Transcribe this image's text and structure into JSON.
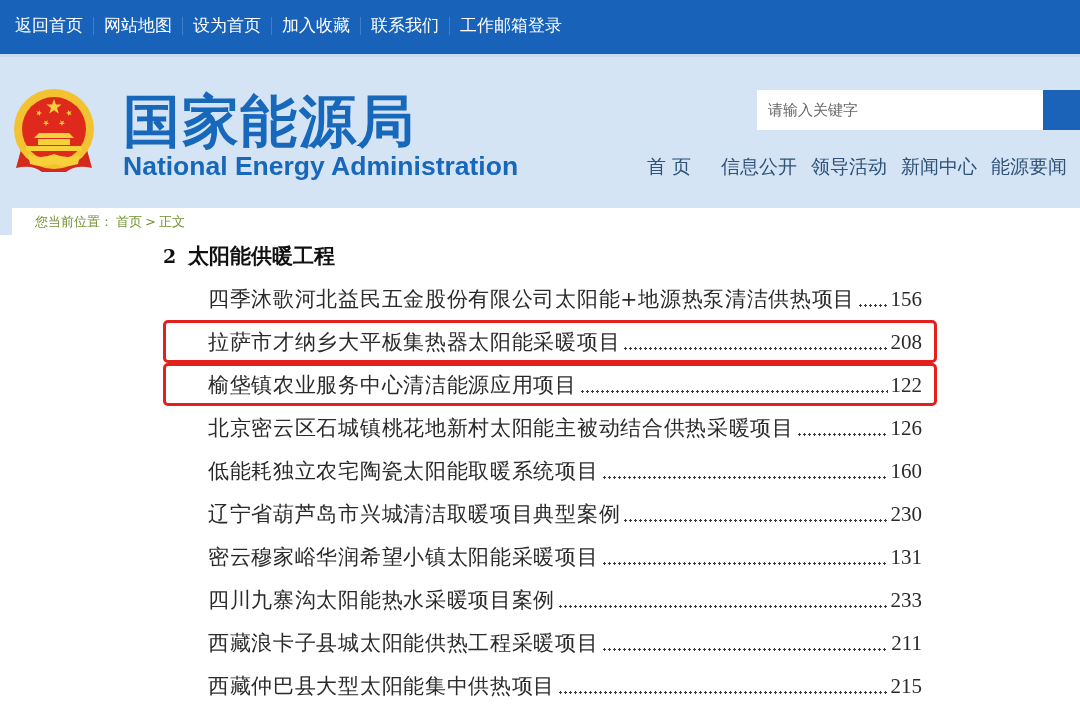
{
  "top_links": [
    "返回首页",
    "网站地图",
    "设为首页",
    "加入收藏",
    "联系我们",
    "工作邮箱登录"
  ],
  "header": {
    "title": "国家能源局",
    "subtitle": "National Energy Administration",
    "search": {
      "placeholder": "请输入关键字"
    },
    "nav": [
      "首 页",
      "信息公开",
      "领导活动",
      "新闻中心",
      "能源要闻"
    ]
  },
  "breadcrumb": {
    "label": "您当前位置：",
    "separator": ">",
    "items": [
      "首页",
      "正文"
    ]
  },
  "section": {
    "number": "2",
    "title": "太阳能供暖工程"
  },
  "entries": [
    {
      "title": "四季沐歌河北益民五金股份有限公司太阳能+地源热泵清洁供热项目",
      "page": "156",
      "highlighted": false
    },
    {
      "title": "拉萨市才纳乡大平板集热器太阳能采暖项目",
      "page": "208",
      "highlighted": true
    },
    {
      "title": "榆垡镇农业服务中心清洁能源应用项目",
      "page": "122",
      "highlighted": true
    },
    {
      "title": "北京密云区石城镇桃花地新村太阳能主被动结合供热采暖项目",
      "page": "126",
      "highlighted": false
    },
    {
      "title": "低能耗独立农宅陶瓷太阳能取暖系统项目",
      "page": "160",
      "highlighted": false
    },
    {
      "title": "辽宁省葫芦岛市兴城清洁取暖项目典型案例",
      "page": "230",
      "highlighted": false
    },
    {
      "title": "密云穆家峪华润希望小镇太阳能采暖项目",
      "page": "131",
      "highlighted": false
    },
    {
      "title": "四川九寨沟太阳能热水采暖项目案例",
      "page": "233",
      "highlighted": false
    },
    {
      "title": "西藏浪卡子县城太阳能供热工程采暖项目",
      "page": "211",
      "highlighted": false
    },
    {
      "title": "西藏仲巴县大型太阳能集中供热项目",
      "page": "215",
      "highlighted": false
    }
  ]
}
